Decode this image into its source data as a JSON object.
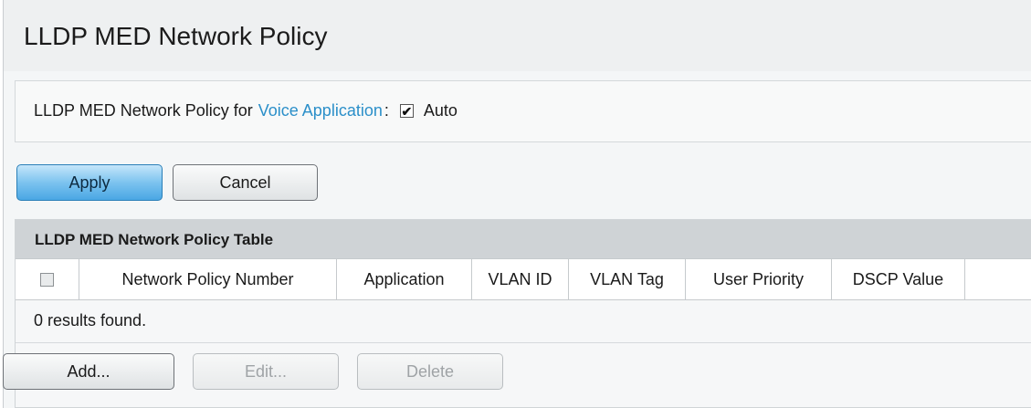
{
  "page": {
    "title": "LLDP MED Network Policy"
  },
  "voice_policy": {
    "label_prefix": "LLDP MED Network Policy for",
    "link_text": "Voice Application",
    "separator": ":",
    "auto_checked": true,
    "check_glyph": "✔",
    "auto_label": "Auto"
  },
  "actions": {
    "apply_label": "Apply",
    "cancel_label": "Cancel"
  },
  "table": {
    "title": "LLDP MED Network Policy Table",
    "columns": [
      "Network Policy Number",
      "Application",
      "VLAN ID",
      "VLAN Tag",
      "User Priority",
      "DSCP Value"
    ],
    "rows": [],
    "empty_message": "0 results found.",
    "add_label": "Add...",
    "edit_label": "Edit...",
    "delete_label": "Delete"
  },
  "colors": {
    "link": "#2b8fc9",
    "apply_button": "#4aa7e4",
    "table_header_bg": "#cfd3d6"
  },
  "icons": {
    "header_checkbox": "checkbox-unchecked-disabled",
    "auto_checkbox": "checkbox-checked"
  }
}
